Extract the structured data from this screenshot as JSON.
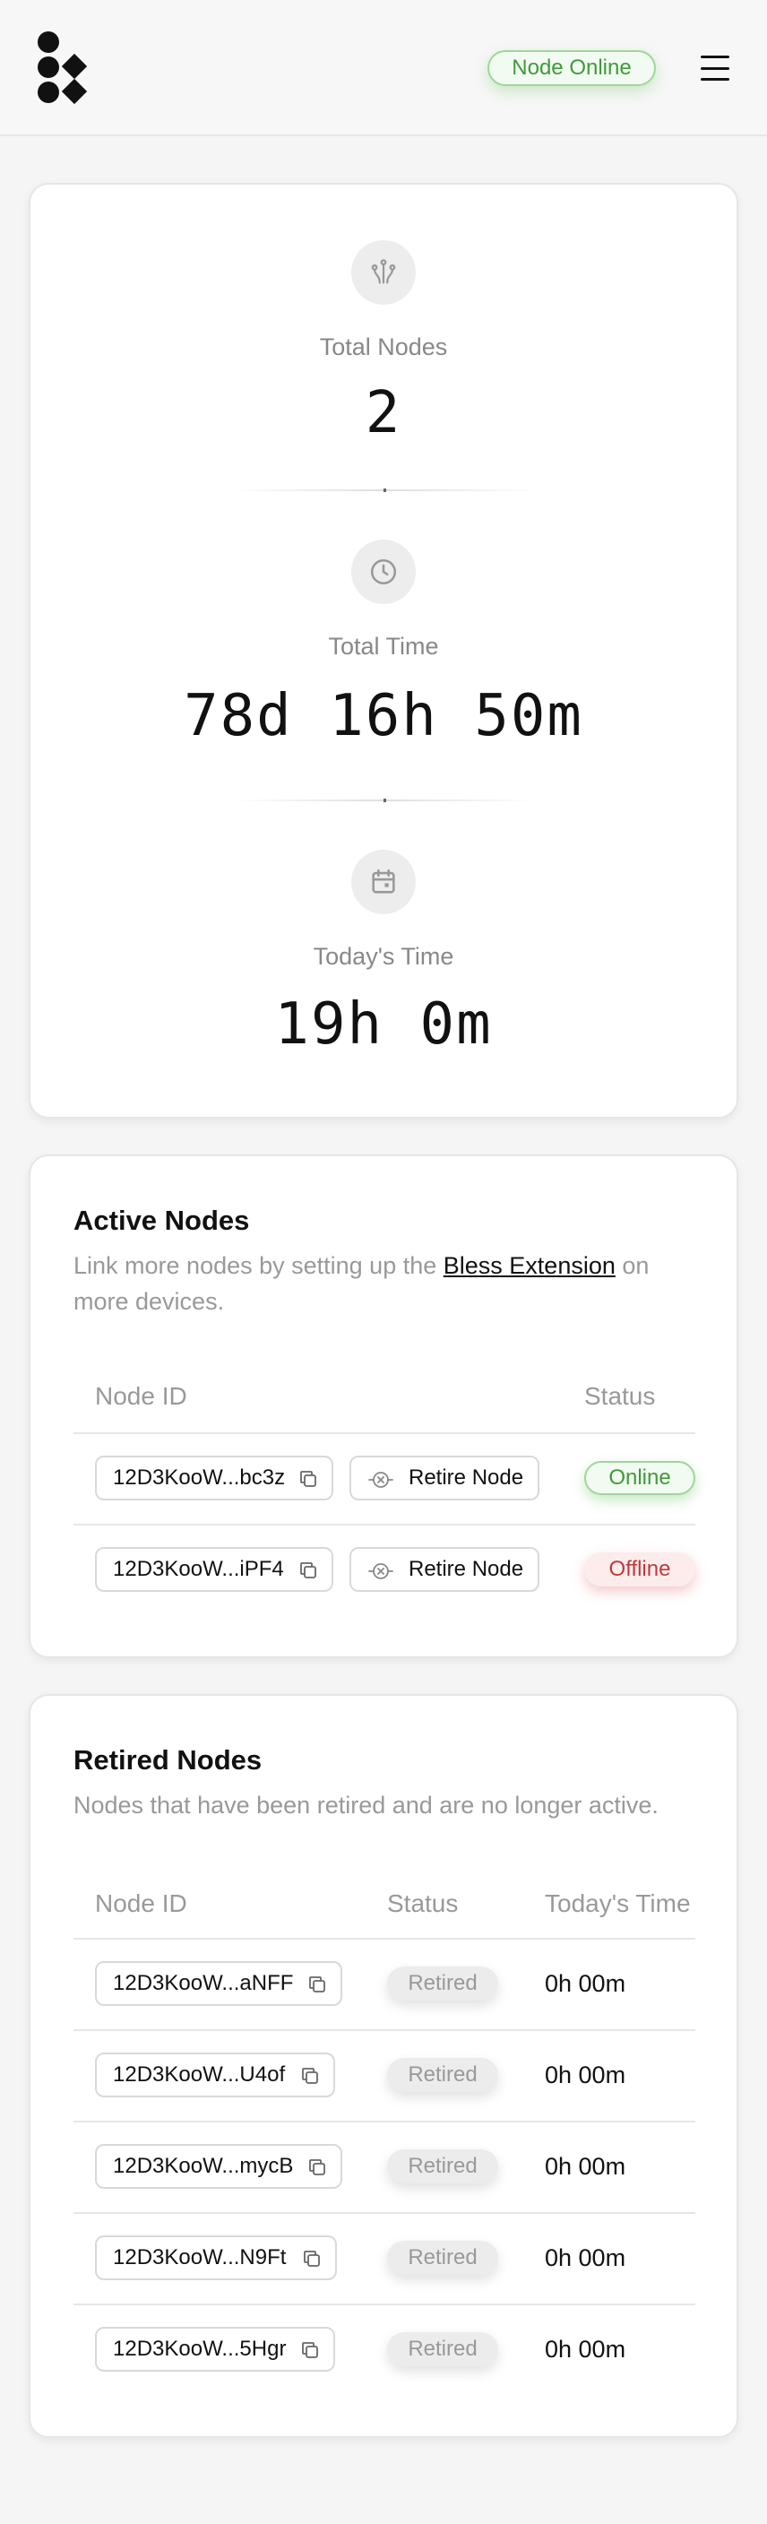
{
  "header": {
    "status_label": "Node Online"
  },
  "stats": {
    "total_nodes": {
      "icon": "antenna-icon",
      "label": "Total Nodes",
      "value": "2"
    },
    "total_time": {
      "icon": "clock-icon",
      "label": "Total Time",
      "value": "78d 16h 50m"
    },
    "today_time": {
      "icon": "calendar-icon",
      "label": "Today's Time",
      "value": "19h 0m"
    }
  },
  "active_nodes": {
    "title": "Active Nodes",
    "desc_before": "Link more nodes by setting up the ",
    "desc_link": "Bless Extension",
    "desc_after": " on more devices.",
    "columns": {
      "node_id": "Node ID",
      "status": "Status"
    },
    "retire_label": "Retire Node",
    "rows": [
      {
        "id": "12D3KooW...bc3z",
        "status": "Online"
      },
      {
        "id": "12D3KooW...iPF4",
        "status": "Offline"
      }
    ]
  },
  "retired_nodes": {
    "title": "Retired Nodes",
    "desc": "Nodes that have been retired and are no longer active.",
    "columns": {
      "node_id": "Node ID",
      "status": "Status",
      "today_time": "Today's Time"
    },
    "rows": [
      {
        "id": "12D3KooW...aNFF",
        "status": "Retired",
        "time": "0h 00m"
      },
      {
        "id": "12D3KooW...U4of",
        "status": "Retired",
        "time": "0h 00m"
      },
      {
        "id": "12D3KooW...mycB",
        "status": "Retired",
        "time": "0h 00m"
      },
      {
        "id": "12D3KooW...N9Ft",
        "status": "Retired",
        "time": "0h 00m"
      },
      {
        "id": "12D3KooW...5Hgr",
        "status": "Retired",
        "time": "0h 00m"
      }
    ]
  },
  "colors": {
    "online": "#3f9a3a",
    "offline": "#c0393b",
    "retired": "#999999"
  }
}
